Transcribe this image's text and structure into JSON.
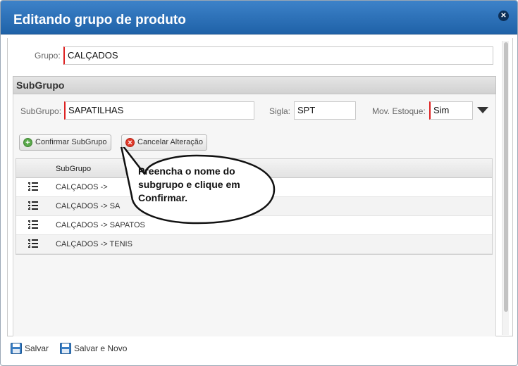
{
  "window": {
    "title": "Editando grupo de produto",
    "close_icon": "close-icon"
  },
  "group": {
    "label": "Grupo:",
    "value": "CALÇADOS"
  },
  "subgroup": {
    "section_title": "SubGrupo",
    "name_label": "SubGrupo:",
    "name_value": "SAPATILHAS",
    "sigla_label": "Sigla:",
    "sigla_value": "SPT",
    "estoque_label": "Mov. Estoque:",
    "estoque_value": "Sim"
  },
  "actions": {
    "confirm_label": "Confirmar SubGrupo",
    "cancel_label": "Cancelar Alteração"
  },
  "grid": {
    "column_header": "SubGrupo",
    "rows": [
      "CALÇADOS -> ",
      "CALÇADOS -> SA",
      "CALÇADOS -> SAPATOS",
      "CALÇADOS -> TENIS"
    ]
  },
  "tooltip": {
    "text": "Preencha o nome do subgrupo e clique em Confirmar."
  },
  "footer": {
    "save_label": "Salvar",
    "save_new_label": "Salvar e Novo"
  },
  "colors": {
    "titlebar": "#2a6db5",
    "required_border": "#dd2222",
    "confirm_icon": "#59a84a",
    "cancel_icon": "#e03a2a"
  }
}
